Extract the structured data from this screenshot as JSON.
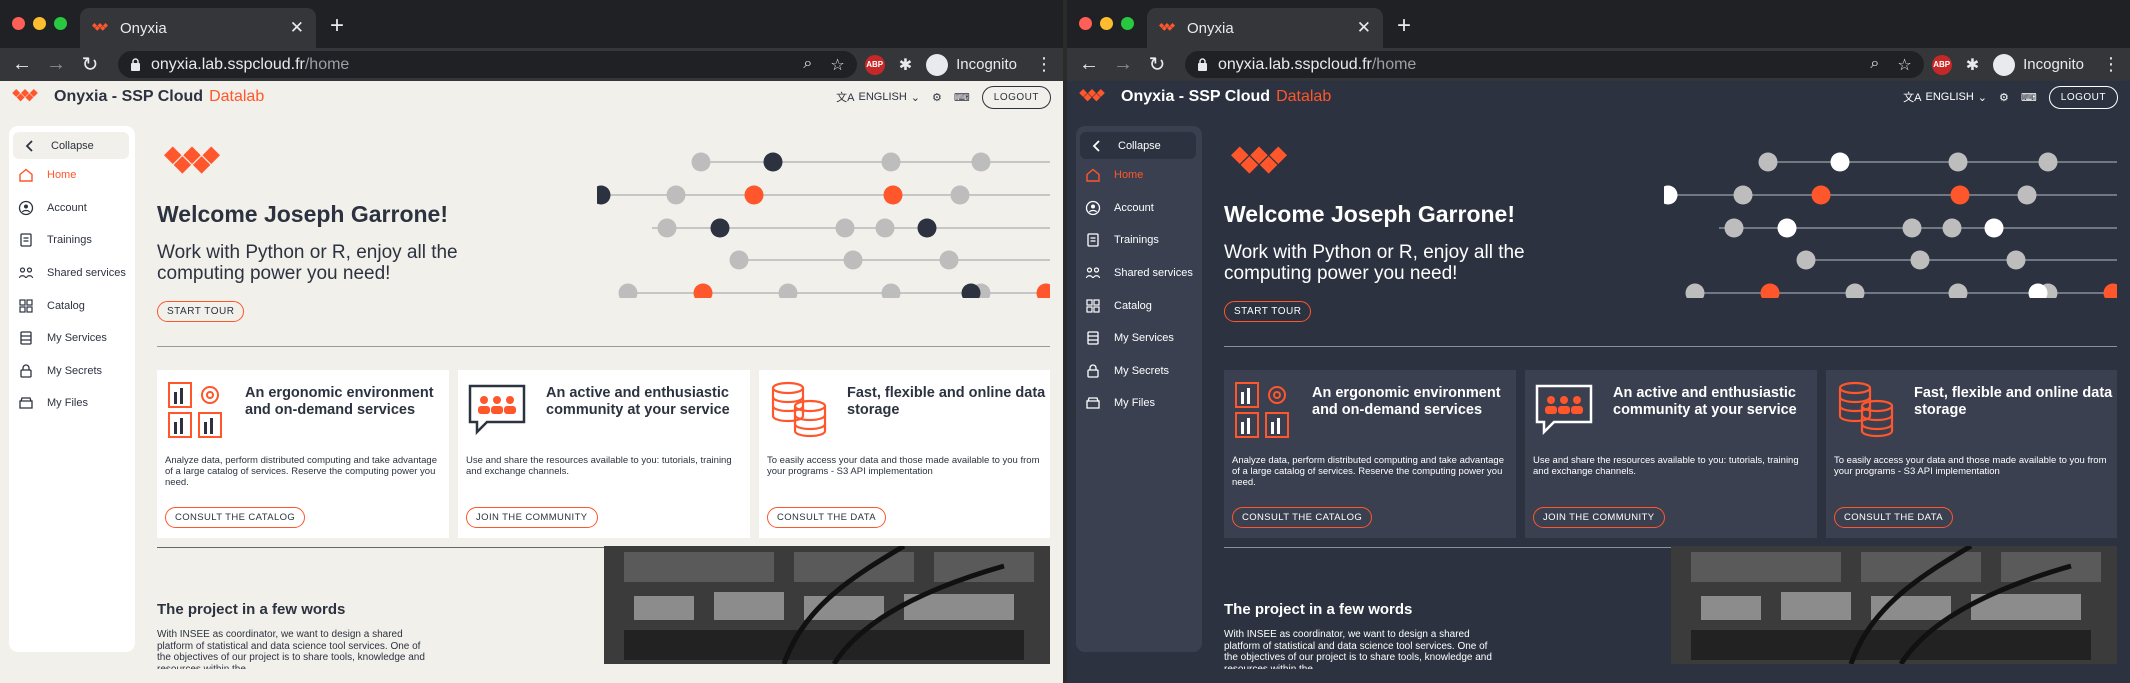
{
  "browser": {
    "tab_title": "Onyxia",
    "url_host": "onyxia.lab.sspcloud.fr",
    "url_path": "/home",
    "profile_label": "Incognito",
    "abp_label": "ABP"
  },
  "app": {
    "name": "Onyxia - SSP Cloud",
    "name_accent": "Datalab",
    "language": "ENGLISH",
    "logout_label": "LOGOUT"
  },
  "sidebar": {
    "items": [
      {
        "label": "Collapse",
        "icon": "chevron-left-icon"
      },
      {
        "label": "Home",
        "icon": "home-icon"
      },
      {
        "label": "Account",
        "icon": "account-icon"
      },
      {
        "label": "Trainings",
        "icon": "trainings-icon"
      },
      {
        "label": "Shared services",
        "icon": "shared-services-icon"
      },
      {
        "label": "Catalog",
        "icon": "catalog-icon"
      },
      {
        "label": "My Services",
        "icon": "services-icon"
      },
      {
        "label": "My Secrets",
        "icon": "lock-icon"
      },
      {
        "label": "My Files",
        "icon": "files-icon"
      }
    ]
  },
  "hero": {
    "welcome": "Welcome Joseph Garrone!",
    "tagline": "Work with Python or R, enjoy all the computing power you need!",
    "start_tour_label": "START TOUR"
  },
  "cards": [
    {
      "title": "An ergonomic environment and on-demand services",
      "description": "Analyze data, perform distributed computing and take advantage of a large catalog of services. Reserve the computing power you need.",
      "button_label": "CONSULT THE CATALOG",
      "icon": "services-grid-icon"
    },
    {
      "title": "An active and enthusiastic community at your service",
      "description": "Use and share the resources available to you: tutorials, training and exchange channels.",
      "button_label": "JOIN THE COMMUNITY",
      "icon": "community-chat-icon"
    },
    {
      "title": "Fast, flexible and online data storage",
      "description": "To easily access your data and those made available to you from your programs - S3 API implementation",
      "button_label": "CONSULT THE DATA",
      "icon": "database-icon"
    }
  ],
  "project": {
    "title": "The project in a few words",
    "text": "With INSEE as coordinator, we want to design a shared platform of statistical and data science tool services. One of the objectives of our project is to share tools, knowledge and resources within the"
  },
  "colors": {
    "accent": "#ff562c",
    "light_bg": "#f1f0eb",
    "dark_bg": "#2c323f",
    "dark_surface": "#3a4050"
  }
}
